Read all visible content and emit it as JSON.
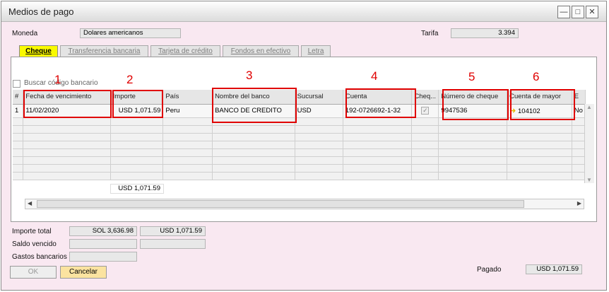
{
  "window": {
    "title": "Medios de pago"
  },
  "header": {
    "moneda_label": "Moneda",
    "moneda_value": "Dolares americanos",
    "tarifa_label": "Tarifa",
    "tarifa_value": "3.394"
  },
  "tabs": [
    {
      "label": "Cheque"
    },
    {
      "label": "Transferencia bancaria"
    },
    {
      "label": "Tarjeta de crédito"
    },
    {
      "label": "Fondos en efectivo"
    },
    {
      "label": "Letra"
    }
  ],
  "search": {
    "label": "Buscar código bancario"
  },
  "grid": {
    "headers": [
      "#",
      "Fecha de vencimiento",
      "Importe",
      "País",
      "Nombre del banco",
      "Sucursal",
      "Cuenta",
      "Cheq...",
      "Número de cheque",
      "Cuenta de mayor",
      "E"
    ],
    "row": {
      "index": "1",
      "fecha": "11/02/2020",
      "importe": "USD 1,071.59",
      "pais": "Peru",
      "banco": "BANCO DE CREDITO",
      "sucursal": "USD",
      "cuenta": "192-0726692-1-32",
      "cheque_checked": true,
      "numero": "9947536",
      "cuenta_mayor": "104102",
      "extra": "No"
    },
    "total_importe": "USD 1,071.59"
  },
  "annotations": [
    "1",
    "2",
    "3",
    "4",
    "5",
    "6"
  ],
  "footer": {
    "importe_total_label": "Importe total",
    "importe_total_sol": "SOL 3,636.98",
    "importe_total_usd": "USD 1,071.59",
    "saldo_vencido_label": "Saldo vencido",
    "gastos_label": "Gastos bancarios",
    "pagado_label": "Pagado",
    "pagado_value": "USD 1,071.59"
  },
  "buttons": {
    "ok": "OK",
    "cancel": "Cancelar"
  },
  "colors": {
    "annotation": "#e00000",
    "active_tab": "#fafa00",
    "window_bg": "#f9e8f1"
  }
}
